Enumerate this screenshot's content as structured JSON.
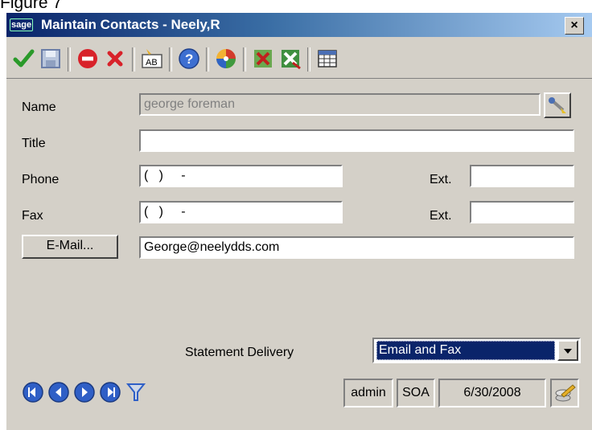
{
  "caption": "Figure 7",
  "window": {
    "logo": "sage",
    "title": "Maintain Contacts - Neely,R",
    "close_label": "×"
  },
  "toolbar": {
    "icons": [
      "checkmark-icon",
      "save-icon",
      "stop-icon",
      "delete-icon",
      "rename-icon",
      "help-icon",
      "disk-icon",
      "green-red-x-icon",
      "red-x-tool-icon",
      "grid-icon"
    ]
  },
  "form": {
    "name_label": "Name",
    "name_value": "george foreman",
    "title_label": "Title",
    "title_value": "",
    "phone_label": "Phone",
    "phone_value": "(   )     -",
    "phone_ext_label": "Ext.",
    "phone_ext_value": "",
    "fax_label": "Fax",
    "fax_value": "(   )     -",
    "fax_ext_label": "Ext.",
    "fax_ext_value": "",
    "email_button": "E-Mail...",
    "email_value": "George@neelydds.com",
    "statement_label": "Statement Delivery",
    "statement_value": "Email and Fax"
  },
  "status": {
    "user": "admin",
    "company": "SOA",
    "date": "6/30/2008"
  },
  "colors": {
    "titlebar": "#0a246a",
    "selection": "#0a246a",
    "nav_blue": "#2f5fc6"
  }
}
